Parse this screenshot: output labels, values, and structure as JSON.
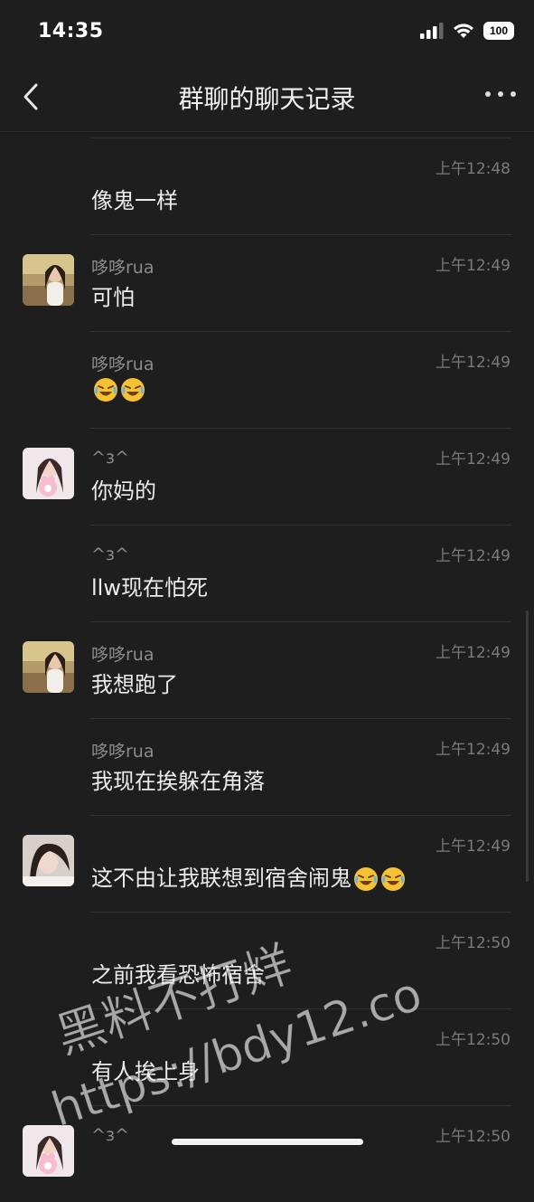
{
  "status": {
    "time": "14:35",
    "battery": "100"
  },
  "nav": {
    "title": "群聊的聊天记录"
  },
  "messages": [
    {
      "sender": "",
      "time": "上午12:48",
      "text": "像鬼一样",
      "avatar": ""
    },
    {
      "sender": "哆哆rua",
      "time": "上午12:49",
      "text": "可怕",
      "avatar": "girl-a"
    },
    {
      "sender": "哆哆rua",
      "time": "上午12:49",
      "text": "",
      "emoji": [
        "crying-laughing-emoji",
        "crying-laughing-emoji"
      ],
      "avatar": ""
    },
    {
      "sender": "^з^",
      "time": "上午12:49",
      "text": "你妈的",
      "avatar": "girl-b"
    },
    {
      "sender": "^з^",
      "time": "上午12:49",
      "text": "llw现在怕死",
      "avatar": ""
    },
    {
      "sender": "哆哆rua",
      "time": "上午12:49",
      "text": "我想跑了",
      "avatar": "girl-a"
    },
    {
      "sender": "哆哆rua",
      "time": "上午12:49",
      "text": "我现在挨躲在角落",
      "avatar": ""
    },
    {
      "sender": "",
      "time": "上午12:49",
      "text": "这不由让我联想到宿舍闹鬼",
      "emoji": [
        "crying-laughing-emoji",
        "crying-laughing-emoji"
      ],
      "avatar": "girl-c"
    },
    {
      "sender": "",
      "time": "上午12:50",
      "text": "之前我看恐怖宿舍",
      "avatar": ""
    },
    {
      "sender": "",
      "time": "上午12:50",
      "text": "有人挨上身",
      "avatar": ""
    },
    {
      "sender": "^з^",
      "time": "上午12:50",
      "text": "",
      "avatar": "girl-b"
    }
  ],
  "watermark": {
    "line1": "黑料不打烊",
    "line2": "https://bdy12.co"
  },
  "colors": {
    "background": "#1e1e1e",
    "divider": "#333333",
    "muted": "#8c8c8c"
  }
}
